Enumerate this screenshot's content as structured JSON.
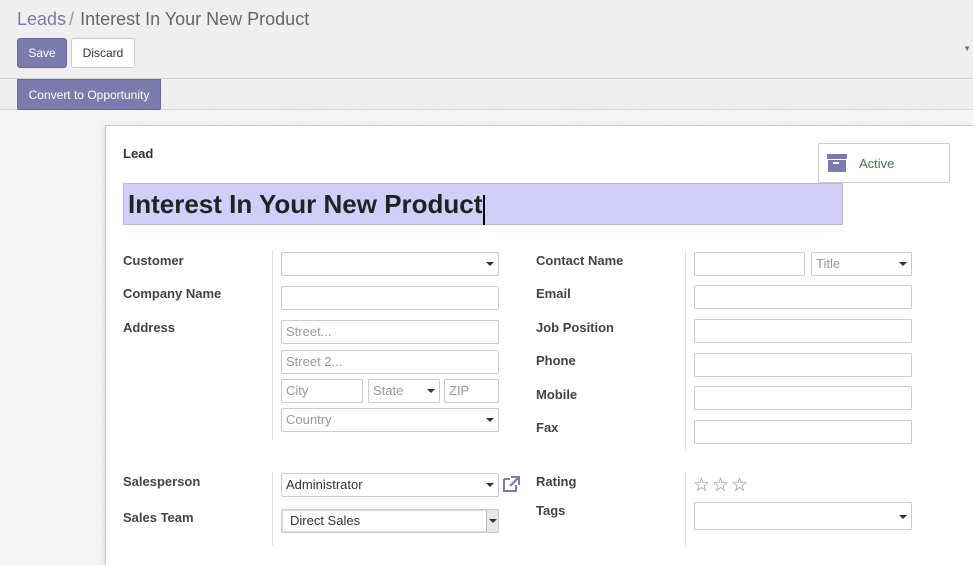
{
  "breadcrumb": {
    "parent": "Leads",
    "separator": "/",
    "current": "Interest In Your New Product"
  },
  "toolbar": {
    "save_label": "Save",
    "discard_label": "Discard"
  },
  "statusbar": {
    "convert_label": "Convert to Opportunity"
  },
  "form": {
    "section_label": "Lead",
    "active_label": "Active",
    "title_value": "Interest In Your New Product",
    "left_labels": {
      "customer": "Customer",
      "company_name": "Company Name",
      "address": "Address",
      "salesperson": "Salesperson",
      "sales_team": "Sales Team"
    },
    "right_labels": {
      "contact_name": "Contact Name",
      "email": "Email",
      "job_position": "Job Position",
      "phone": "Phone",
      "mobile": "Mobile",
      "fax": "Fax",
      "rating": "Rating",
      "tags": "Tags"
    },
    "placeholders": {
      "street": "Street...",
      "street2": "Street 2...",
      "city": "City",
      "state": "State",
      "zip": "ZIP",
      "country": "Country",
      "title": "Title"
    },
    "values": {
      "salesperson": "Administrator",
      "sales_team": "Direct Sales"
    },
    "rating": {
      "stars": [
        "☆",
        "☆",
        "☆"
      ],
      "value": 0,
      "max": 3
    }
  },
  "icons": {
    "archive": "archive-icon",
    "external_link": "external-link-icon",
    "star": "star-icon"
  },
  "colors": {
    "primary": "#7c7bad",
    "title_highlight": "#cfcffa",
    "active_text": "#3e7d4a"
  }
}
